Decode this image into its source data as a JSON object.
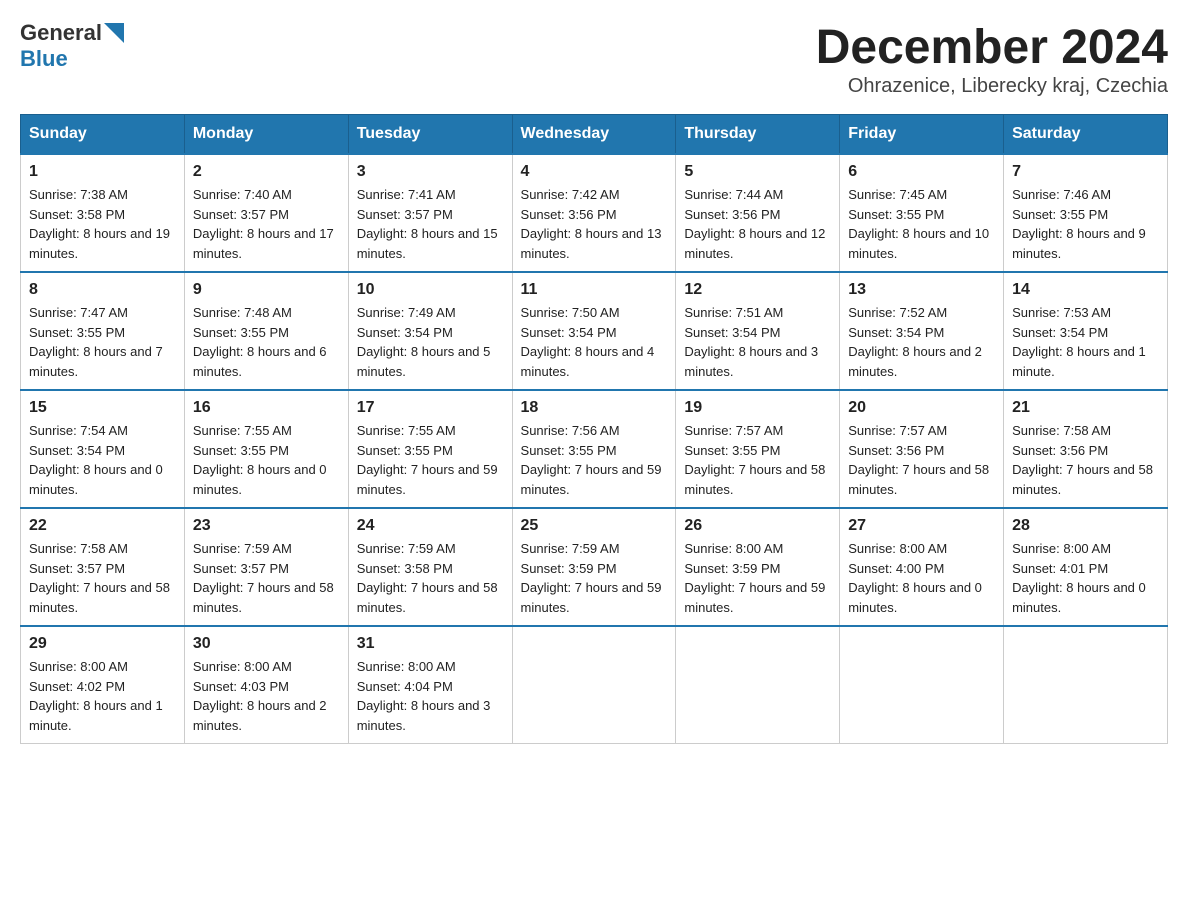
{
  "header": {
    "logo_general": "General",
    "logo_blue": "Blue",
    "title": "December 2024",
    "subtitle": "Ohrazenice, Liberecky kraj, Czechia"
  },
  "weekdays": [
    "Sunday",
    "Monday",
    "Tuesday",
    "Wednesday",
    "Thursday",
    "Friday",
    "Saturday"
  ],
  "weeks": [
    [
      {
        "day": "1",
        "sunrise": "7:38 AM",
        "sunset": "3:58 PM",
        "daylight": "8 hours and 19 minutes."
      },
      {
        "day": "2",
        "sunrise": "7:40 AM",
        "sunset": "3:57 PM",
        "daylight": "8 hours and 17 minutes."
      },
      {
        "day": "3",
        "sunrise": "7:41 AM",
        "sunset": "3:57 PM",
        "daylight": "8 hours and 15 minutes."
      },
      {
        "day": "4",
        "sunrise": "7:42 AM",
        "sunset": "3:56 PM",
        "daylight": "8 hours and 13 minutes."
      },
      {
        "day": "5",
        "sunrise": "7:44 AM",
        "sunset": "3:56 PM",
        "daylight": "8 hours and 12 minutes."
      },
      {
        "day": "6",
        "sunrise": "7:45 AM",
        "sunset": "3:55 PM",
        "daylight": "8 hours and 10 minutes."
      },
      {
        "day": "7",
        "sunrise": "7:46 AM",
        "sunset": "3:55 PM",
        "daylight": "8 hours and 9 minutes."
      }
    ],
    [
      {
        "day": "8",
        "sunrise": "7:47 AM",
        "sunset": "3:55 PM",
        "daylight": "8 hours and 7 minutes."
      },
      {
        "day": "9",
        "sunrise": "7:48 AM",
        "sunset": "3:55 PM",
        "daylight": "8 hours and 6 minutes."
      },
      {
        "day": "10",
        "sunrise": "7:49 AM",
        "sunset": "3:54 PM",
        "daylight": "8 hours and 5 minutes."
      },
      {
        "day": "11",
        "sunrise": "7:50 AM",
        "sunset": "3:54 PM",
        "daylight": "8 hours and 4 minutes."
      },
      {
        "day": "12",
        "sunrise": "7:51 AM",
        "sunset": "3:54 PM",
        "daylight": "8 hours and 3 minutes."
      },
      {
        "day": "13",
        "sunrise": "7:52 AM",
        "sunset": "3:54 PM",
        "daylight": "8 hours and 2 minutes."
      },
      {
        "day": "14",
        "sunrise": "7:53 AM",
        "sunset": "3:54 PM",
        "daylight": "8 hours and 1 minute."
      }
    ],
    [
      {
        "day": "15",
        "sunrise": "7:54 AM",
        "sunset": "3:54 PM",
        "daylight": "8 hours and 0 minutes."
      },
      {
        "day": "16",
        "sunrise": "7:55 AM",
        "sunset": "3:55 PM",
        "daylight": "8 hours and 0 minutes."
      },
      {
        "day": "17",
        "sunrise": "7:55 AM",
        "sunset": "3:55 PM",
        "daylight": "7 hours and 59 minutes."
      },
      {
        "day": "18",
        "sunrise": "7:56 AM",
        "sunset": "3:55 PM",
        "daylight": "7 hours and 59 minutes."
      },
      {
        "day": "19",
        "sunrise": "7:57 AM",
        "sunset": "3:55 PM",
        "daylight": "7 hours and 58 minutes."
      },
      {
        "day": "20",
        "sunrise": "7:57 AM",
        "sunset": "3:56 PM",
        "daylight": "7 hours and 58 minutes."
      },
      {
        "day": "21",
        "sunrise": "7:58 AM",
        "sunset": "3:56 PM",
        "daylight": "7 hours and 58 minutes."
      }
    ],
    [
      {
        "day": "22",
        "sunrise": "7:58 AM",
        "sunset": "3:57 PM",
        "daylight": "7 hours and 58 minutes."
      },
      {
        "day": "23",
        "sunrise": "7:59 AM",
        "sunset": "3:57 PM",
        "daylight": "7 hours and 58 minutes."
      },
      {
        "day": "24",
        "sunrise": "7:59 AM",
        "sunset": "3:58 PM",
        "daylight": "7 hours and 58 minutes."
      },
      {
        "day": "25",
        "sunrise": "7:59 AM",
        "sunset": "3:59 PM",
        "daylight": "7 hours and 59 minutes."
      },
      {
        "day": "26",
        "sunrise": "8:00 AM",
        "sunset": "3:59 PM",
        "daylight": "7 hours and 59 minutes."
      },
      {
        "day": "27",
        "sunrise": "8:00 AM",
        "sunset": "4:00 PM",
        "daylight": "8 hours and 0 minutes."
      },
      {
        "day": "28",
        "sunrise": "8:00 AM",
        "sunset": "4:01 PM",
        "daylight": "8 hours and 0 minutes."
      }
    ],
    [
      {
        "day": "29",
        "sunrise": "8:00 AM",
        "sunset": "4:02 PM",
        "daylight": "8 hours and 1 minute."
      },
      {
        "day": "30",
        "sunrise": "8:00 AM",
        "sunset": "4:03 PM",
        "daylight": "8 hours and 2 minutes."
      },
      {
        "day": "31",
        "sunrise": "8:00 AM",
        "sunset": "4:04 PM",
        "daylight": "8 hours and 3 minutes."
      },
      null,
      null,
      null,
      null
    ]
  ],
  "labels": {
    "sunrise": "Sunrise:",
    "sunset": "Sunset:",
    "daylight": "Daylight:"
  }
}
